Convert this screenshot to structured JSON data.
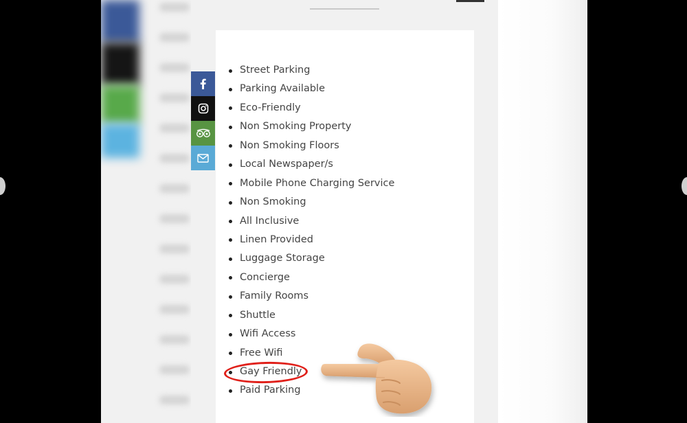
{
  "social": {
    "facebook": {
      "icon": "facebook-icon",
      "color": "#3b5998"
    },
    "instagram": {
      "icon": "instagram-icon",
      "color": "#111111"
    },
    "tripadvisor": {
      "icon": "tripadvisor-icon",
      "color": "#589442"
    },
    "email": {
      "icon": "email-icon",
      "color": "#5aaad6"
    }
  },
  "amenities": {
    "items": [
      "Street Parking",
      "Parking Available",
      "Eco-Friendly",
      "Non Smoking Property",
      "Non Smoking Floors",
      "Local Newspaper/s",
      "Mobile Phone Charging Service",
      "Non Smoking",
      "All Inclusive",
      "Linen Provided",
      "Luggage Storage",
      "Concierge",
      "Family Rooms",
      "Shuttle",
      "Wifi Access",
      "Free Wifi",
      "Gay Friendly",
      "Paid Parking"
    ],
    "highlighted": "Gay Friendly"
  },
  "annotation": {
    "circle_color": "#e0201a",
    "pointer": "pointing-hand-icon"
  }
}
